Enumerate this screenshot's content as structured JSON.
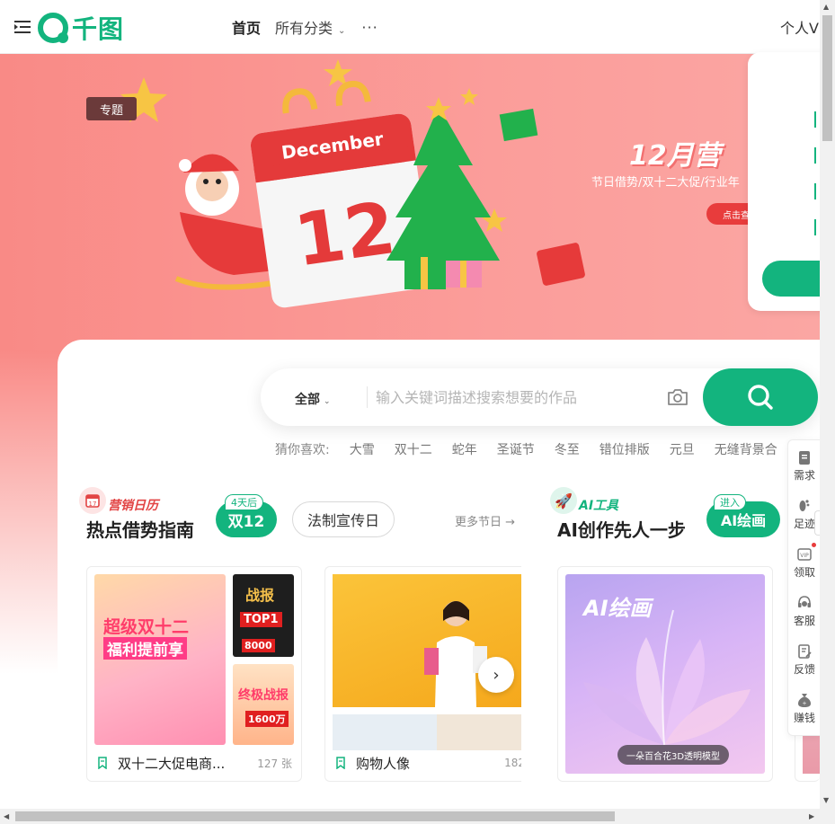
{
  "header": {
    "home": "首页",
    "categories": "所有分类",
    "more": "···",
    "personal": "个人V",
    "logo_text": "千图"
  },
  "banner": {
    "tag": "专题",
    "title": "12月营",
    "subtitle": "节日借势/双十二大促/行业年",
    "button": "点击查",
    "calendar_month": "December",
    "calendar_day": "12",
    "dots": 8,
    "active_dot": 1
  },
  "search": {
    "scope": "全部",
    "placeholder": "输入关键词描述搜索想要的作品"
  },
  "guess": {
    "label": "猜你喜欢:",
    "items": [
      "大雪",
      "双十二",
      "蛇年",
      "圣诞节",
      "冬至",
      "错位排版",
      "元旦",
      "无缝背景合"
    ]
  },
  "marketing": {
    "tag": "营销日历",
    "title": "热点借势指南",
    "pill": "双12",
    "pill_badge": "4天后",
    "pill2": "法制宣传日",
    "more": "更多节日 →"
  },
  "ai": {
    "tag": "AI工具",
    "title": "AI创作先人一步",
    "pill": "AI绘画",
    "pill_badge": "进入"
  },
  "cards": [
    {
      "label": "双十二大促电商...",
      "count": "127 张",
      "texts": [
        "超级双十二",
        "福利提前享",
        "战报",
        "TOP1",
        "8000",
        "终极战报",
        "1600万"
      ]
    },
    {
      "label": "购物人像",
      "count": "182"
    },
    {
      "title": "AI绘画",
      "caption": "一朵百合花3D透明模型"
    }
  ],
  "toolbar": {
    "items": [
      "需求",
      "足迹",
      "领取",
      "客服",
      "反馈",
      "赚钱"
    ]
  },
  "colors": {
    "brand": "#13b47e",
    "banner": "#f98a86",
    "accent_red": "#e24444"
  }
}
